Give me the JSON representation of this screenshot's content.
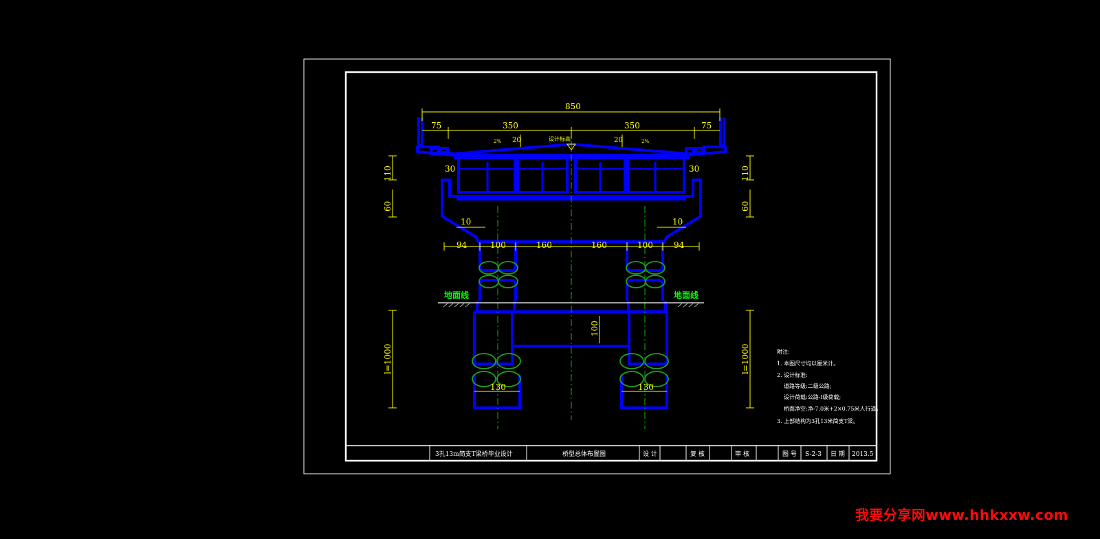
{
  "dimensions": {
    "overall": "850",
    "half_left": "350",
    "half_right": "350",
    "sidewalk_left": "75",
    "sidewalk_right": "75",
    "slab_left": "20",
    "slab_right": "20",
    "cap_end_left": "30",
    "cap_end_right": "30",
    "height_top_left": "110",
    "height_top_right": "110",
    "height_cap_left": "60",
    "height_cap_right": "60",
    "chamfer_left": "10",
    "chamfer_right": "10",
    "bot_94_left": "94",
    "bot_100_left": "100",
    "bot_160_left": "160",
    "bot_160_right": "160",
    "bot_100_right": "100",
    "bot_94_right": "94",
    "tie_beam": "100",
    "pile_dia_left": "130",
    "pile_dia_right": "130",
    "pile_len_left": "l=1000",
    "pile_len_right": "l=1000",
    "slope_left": "2%",
    "slope_right": "2%"
  },
  "labels": {
    "design_elevation": "设计标高",
    "ground_left": "地面线",
    "ground_right": "地面线"
  },
  "notes": {
    "heading": "附注:",
    "lines": [
      "1. 本图尺寸均以厘米计。",
      "2. 设计标准:",
      "道路等级:二级公路;",
      "设计荷载:公路-I级荷载;",
      "桥面净空:净-7.0米+2×0.75米人行道。",
      "3. 上部结构为3孔13米简支T梁。"
    ]
  },
  "title_block": {
    "project": "3孔13m简支T梁桥毕业设计",
    "drawing": "桥型总体布置图",
    "design_label": "设 计",
    "check_label": "复 核",
    "review_label": "审 核",
    "drawing_no_label": "图 号",
    "drawing_no": "S-2-3",
    "date_label": "日 期",
    "date": "2013.5"
  },
  "watermark": "我要分享网www.hhkxxw.com",
  "colors": {
    "background": "#000000",
    "structure": "#0000ff",
    "dimension": "#ffff00",
    "centerline": "#00cc00",
    "ground_label": "#00ff00",
    "frame": "#ffffff",
    "watermark": "#ff0a0a"
  }
}
